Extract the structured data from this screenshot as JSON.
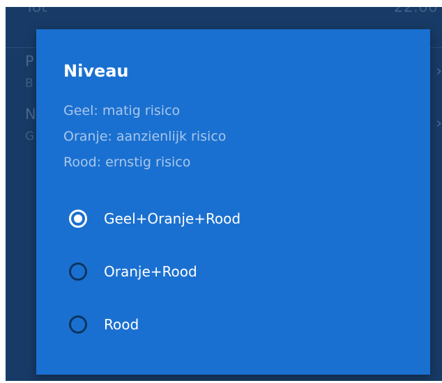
{
  "background": {
    "row_label": "Tot",
    "row_time": "22:00",
    "item1_initial": "P",
    "item1_sub_initial": "B",
    "item2_initial": "N",
    "item2_sub_initial": "G",
    "chevron": "›"
  },
  "dialog": {
    "title": "Niveau",
    "descriptions": [
      "Geel: matig risico",
      "Oranje: aanzienlijk risico",
      "Rood: ernstig risico"
    ],
    "options": [
      {
        "label": "Geel+Oranje+Rood",
        "selected": true
      },
      {
        "label": "Oranje+Rood",
        "selected": false
      },
      {
        "label": "Rood",
        "selected": false
      }
    ]
  },
  "colors": {
    "screen_background": "#173b66",
    "dialog_background": "#1a70d0",
    "description_text": "#a8c7ec",
    "radio_unselected": "#0c3560",
    "radio_selected": "#ffffff"
  }
}
